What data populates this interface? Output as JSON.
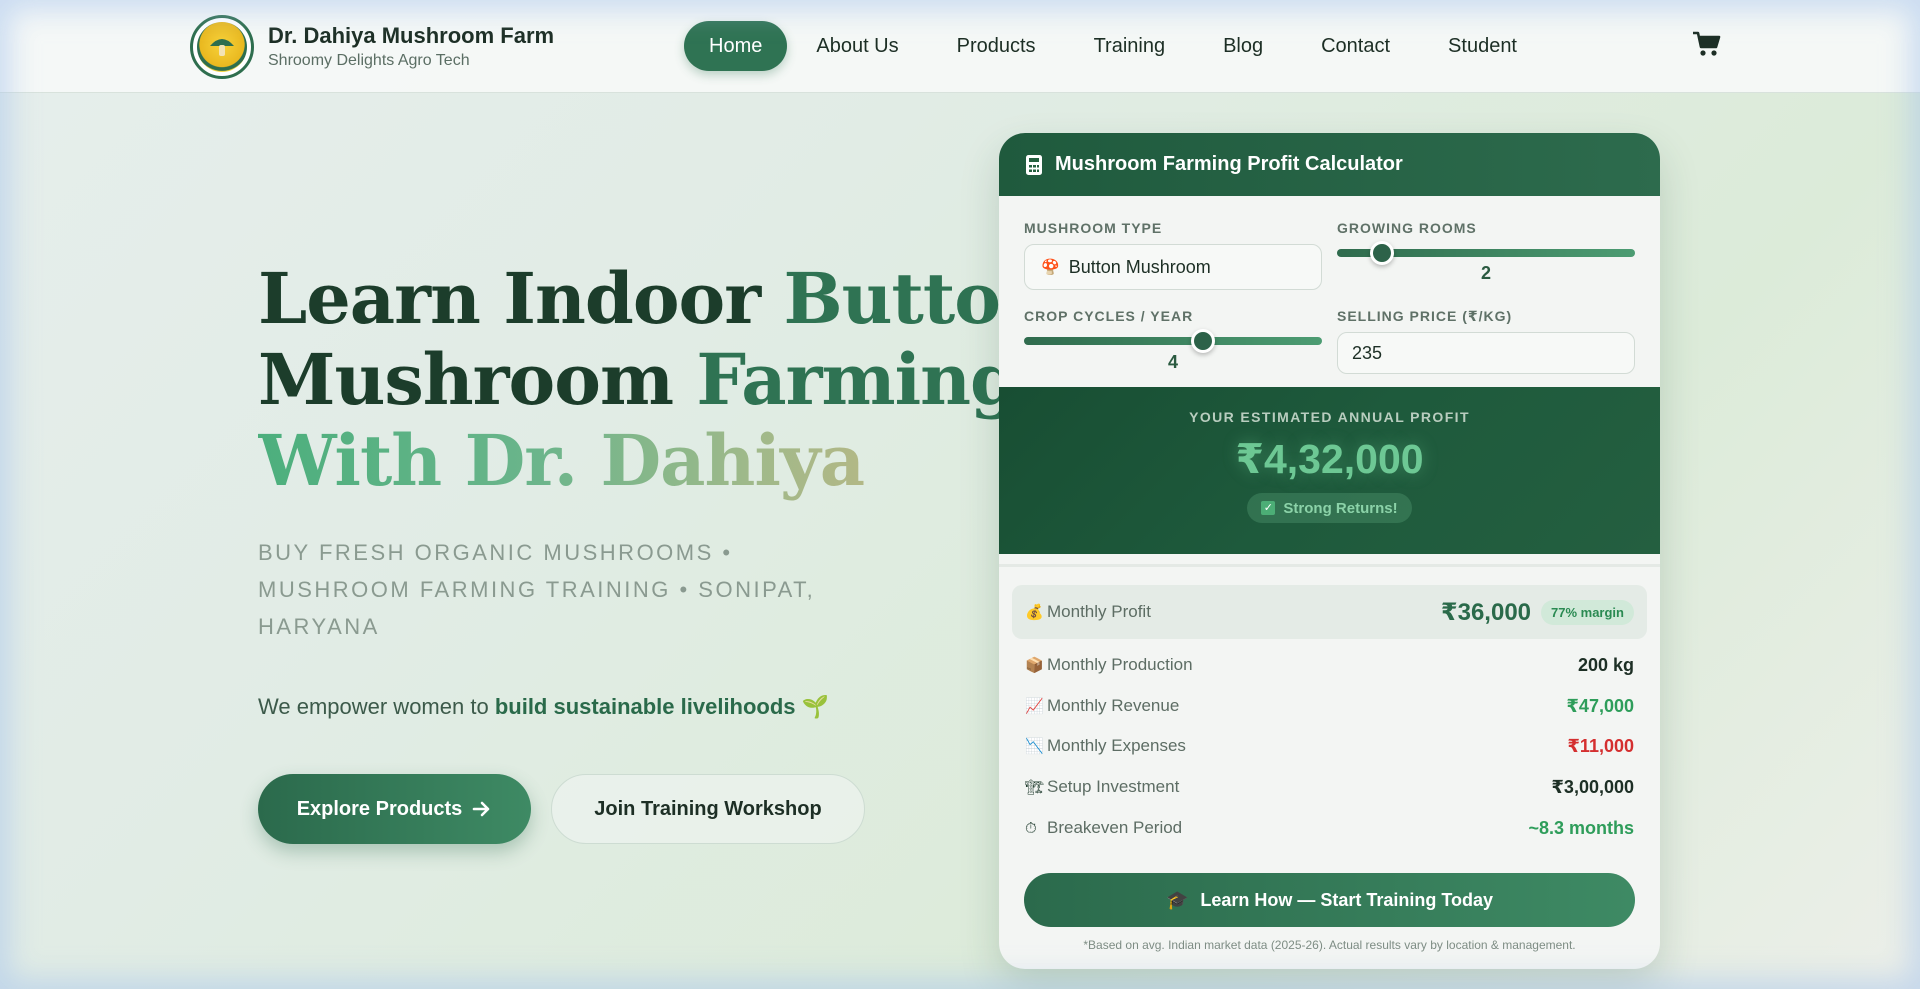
{
  "brand": {
    "title": "Dr. Dahiya Mushroom Farm",
    "subtitle": "Shroomy Delights Agro Tech",
    "logo_icon": "mushroom-logo-icon"
  },
  "nav": {
    "items": [
      {
        "label": "Home",
        "active": true
      },
      {
        "label": "About Us",
        "active": false
      },
      {
        "label": "Products",
        "active": false
      },
      {
        "label": "Training",
        "active": false
      },
      {
        "label": "Blog",
        "active": false
      },
      {
        "label": "Contact",
        "active": false
      },
      {
        "label": "Student",
        "active": false
      }
    ],
    "cart_icon": "cart-icon"
  },
  "hero": {
    "title_line1_a": "Learn Indoor",
    "title_line1_b": "Button",
    "title_line2_a": "Mushroom",
    "title_line2_b": "Farming",
    "title_line3": "With Dr. Dahiya",
    "tagline": "BUY FRESH ORGANIC MUSHROOMS • MUSHROOM FARMING TRAINING • SONIPAT, HARYANA",
    "mission_prefix": "We empower women to",
    "mission_bold": "build sustainable livelihoods",
    "mission_emoji": "🌱",
    "primary_button": "Explore Products",
    "secondary_button": "Join Training Workshop"
  },
  "calculator": {
    "title": "Mushroom Farming Profit Calculator",
    "mushroom_type_label": "MUSHROOM TYPE",
    "mushroom_type_value": "Button Mushroom",
    "growing_rooms_label": "GROWING ROOMS",
    "growing_rooms_value": "2",
    "growing_rooms_fraction": 0.15,
    "crop_cycles_label": "CROP CYCLES / YEAR",
    "crop_cycles_value": "4",
    "crop_cycles_fraction": 0.6,
    "selling_price_label": "SELLING PRICE (₹/KG)",
    "selling_price_value": "235",
    "profit_label": "YOUR ESTIMATED ANNUAL PROFIT",
    "profit_value": "₹4,32,000",
    "profit_badge": "Strong Returns!",
    "rows": [
      {
        "icon": "💰",
        "label": "Monthly Profit",
        "value": "₹36,000",
        "badge": "77% margin"
      },
      {
        "icon": "📦",
        "label": "Monthly Production",
        "value": "200 kg"
      },
      {
        "icon": "📈",
        "label": "Monthly Revenue",
        "value": "₹47,000"
      },
      {
        "icon": "📉",
        "label": "Monthly Expenses",
        "value": "₹11,000"
      },
      {
        "icon": "🏗",
        "label": "Setup Investment",
        "value": "₹3,00,000"
      },
      {
        "icon": "⏱",
        "label": "Breakeven Period",
        "value": "~8.3 months"
      }
    ],
    "cta_label": "Learn How — Start Training Today",
    "footnote": "*Based on avg. Indian market data (2025-26). Actual results vary by location & management.",
    "colors": {
      "accent": "#2f7353",
      "positive": "#2e9d5a",
      "negative": "#d42f2f"
    }
  }
}
